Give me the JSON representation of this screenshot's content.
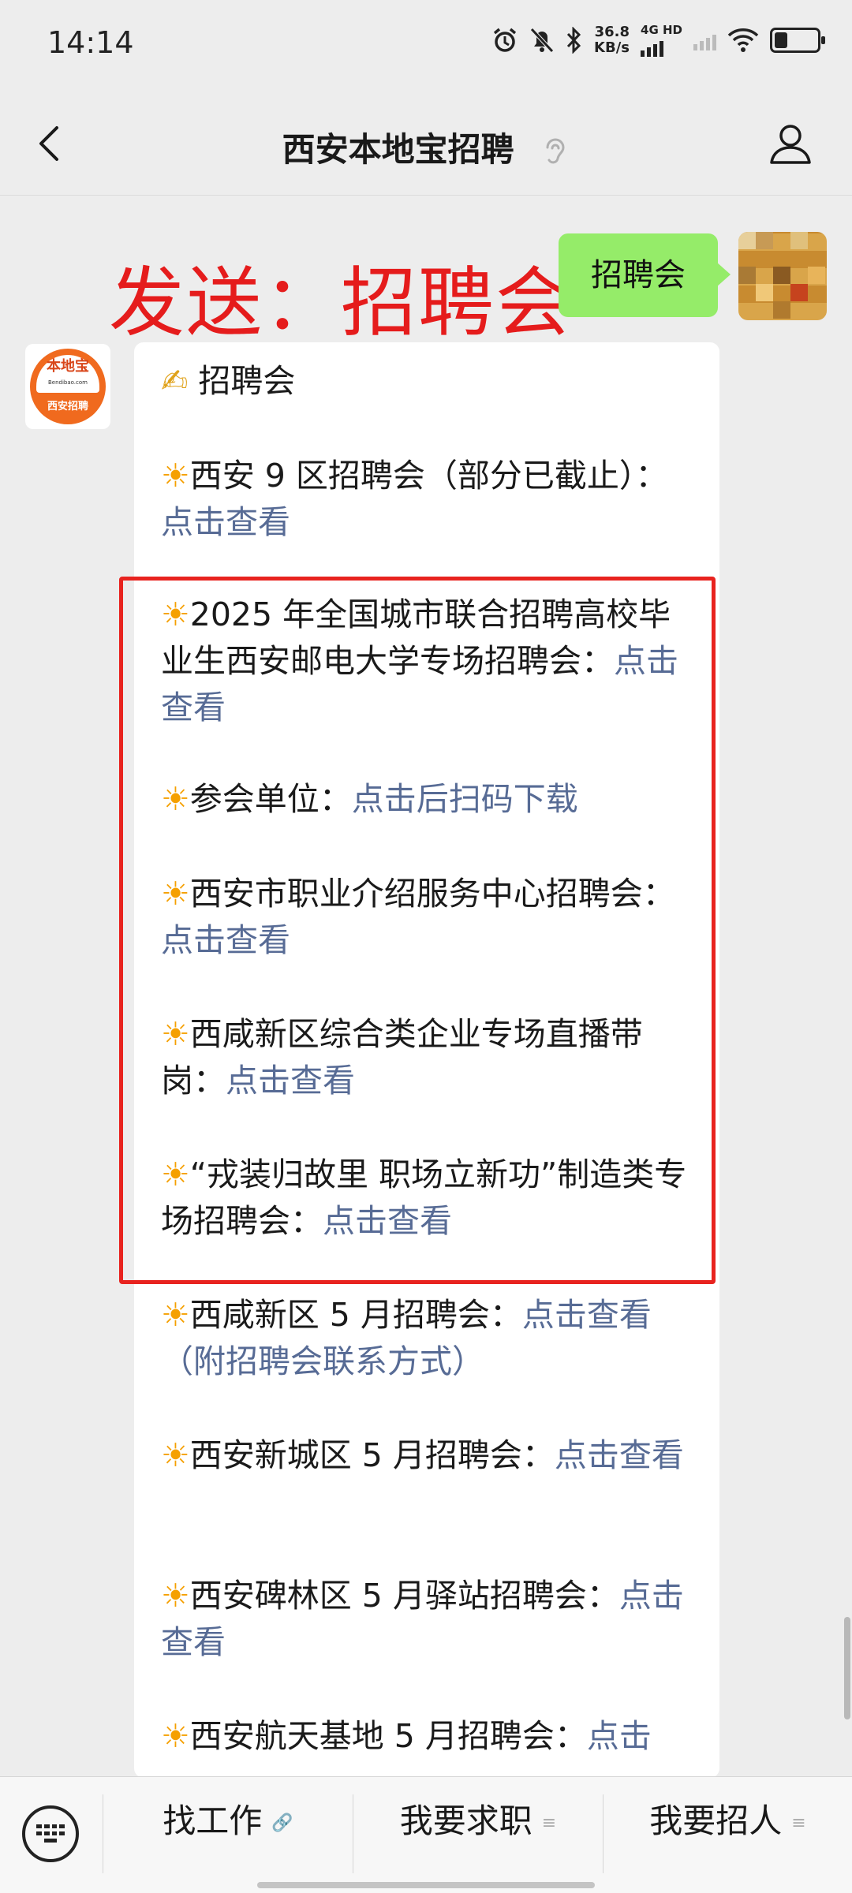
{
  "status_bar": {
    "time": "14:14",
    "net_speed_value": "36.8",
    "net_speed_unit": "KB/s",
    "network": "4G HD",
    "battery_level": 0.3
  },
  "nav": {
    "title": "西安本地宝招聘"
  },
  "overlay": {
    "text": "发送：招聘会"
  },
  "sent_message": {
    "text": "招聘会"
  },
  "bot": {
    "logo_main": "本地宝",
    "logo_url": "Bendibao.com",
    "logo_sub": "西安招聘"
  },
  "reply": {
    "heading_icon": "✍",
    "heading": "招聘会",
    "items": [
      {
        "text": "西安 9 区招聘会（部分已截止）：",
        "link": "点击查看"
      },
      {
        "text": "2025 年全国城市联合招聘高校毕业生西安邮电大学专场招聘会：",
        "link": "点击查看"
      },
      {
        "text": "参会单位：",
        "link": "点击后扫码下载"
      },
      {
        "text": "西安市职业介绍服务中心招聘会：",
        "link": "点击查看"
      },
      {
        "text": "西咸新区综合类企业专场直播带岗：",
        "link": "点击查看"
      },
      {
        "text": "“戎装归故里  职场立新功”制造类专场招聘会：",
        "link": "点击查看"
      },
      {
        "text": "西咸新区 5 月招聘会：",
        "link": "点击查看（附招聘会联系方式）"
      },
      {
        "text": "西安新城区 5 月招聘会：",
        "link": "点击查看"
      },
      {
        "text": "西安碑林区 5 月驿站招聘会：",
        "link": "点击查看"
      },
      {
        "text": "西安航天基地 5 月招聘会：",
        "link": "点击"
      }
    ]
  },
  "bottom_menu": {
    "items": [
      "找工作",
      "我要求职",
      "我要招人"
    ]
  },
  "colors": {
    "highlight": "#e8231f",
    "link": "#576b95",
    "sent_bubble": "#95ec69",
    "overlay_text": "#e51c1c"
  }
}
